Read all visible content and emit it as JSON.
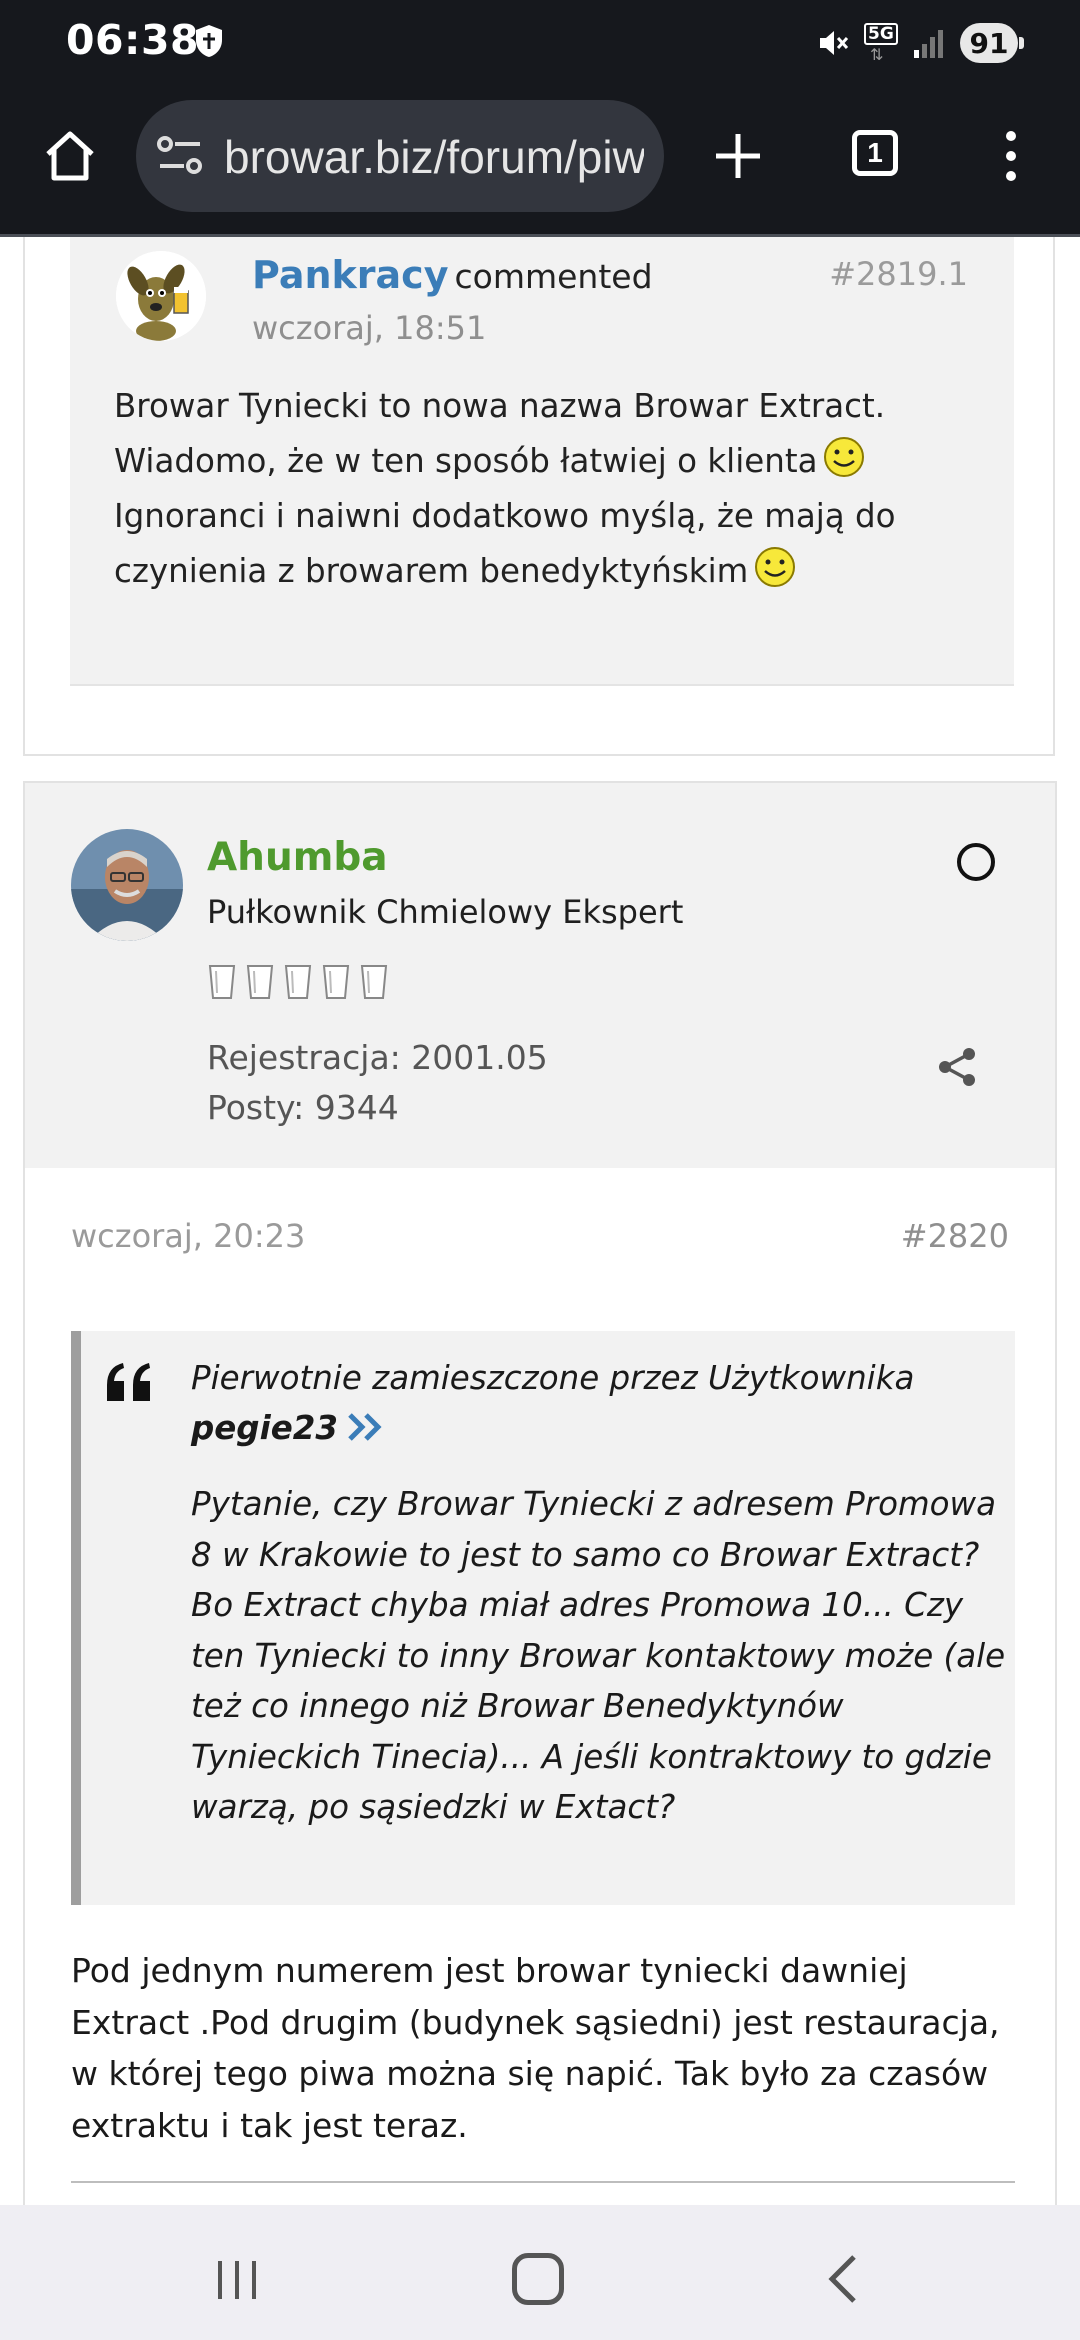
{
  "status_bar": {
    "time": "06:38",
    "network": "5G",
    "battery": "91"
  },
  "browser": {
    "url": "browar.biz/forum/piw",
    "tab_count": "1"
  },
  "comment": {
    "author": "Pankracy",
    "verb": "commented",
    "date": "wczoraj, 18:51",
    "number": "#2819.1",
    "line1": "Browar Tyniecki to nowa nazwa Browar Extract.",
    "line2": "Wiadomo, że w ten sposób łatwiej o klienta",
    "line3": "Ignoranci i naiwni dodatkowo myślą, że mają do",
    "line4": "czynienia z browarem benedyktyńskim"
  },
  "post": {
    "user": {
      "name": "Ahumba",
      "rank": "Pułkownik Chmielowy Ekspert",
      "registration": "Rejestracja: 2001.05",
      "posts": "Posty: 9344",
      "cups": 5
    },
    "date": "wczoraj, 20:23",
    "number": "#2820",
    "quote": {
      "intro": "Pierwotnie zamieszczone przez Użytkownika",
      "user": "pegie23",
      "text": "Pytanie, czy Browar Tyniecki z adresem Promowa 8 w Krakowie to jest to samo co Browar Extract? Bo Extract chyba miał adres Promowa 10... Czy ten Tyniecki to inny Browar kontaktowy może (ale też co innego niż Browar Benedyktynów Tynieckich Tinecia)... A jeśli kontraktowy to gdzie warzą, po sąsiedzki w Extact?"
    },
    "body": "Pod jednym numerem jest browar tyniecki dawniej Extract .Pod drugim (budynek sąsiedni) jest restauracja, w której tego piwa można się napić. Tak było za czasów extraktu i tak jest teraz."
  }
}
